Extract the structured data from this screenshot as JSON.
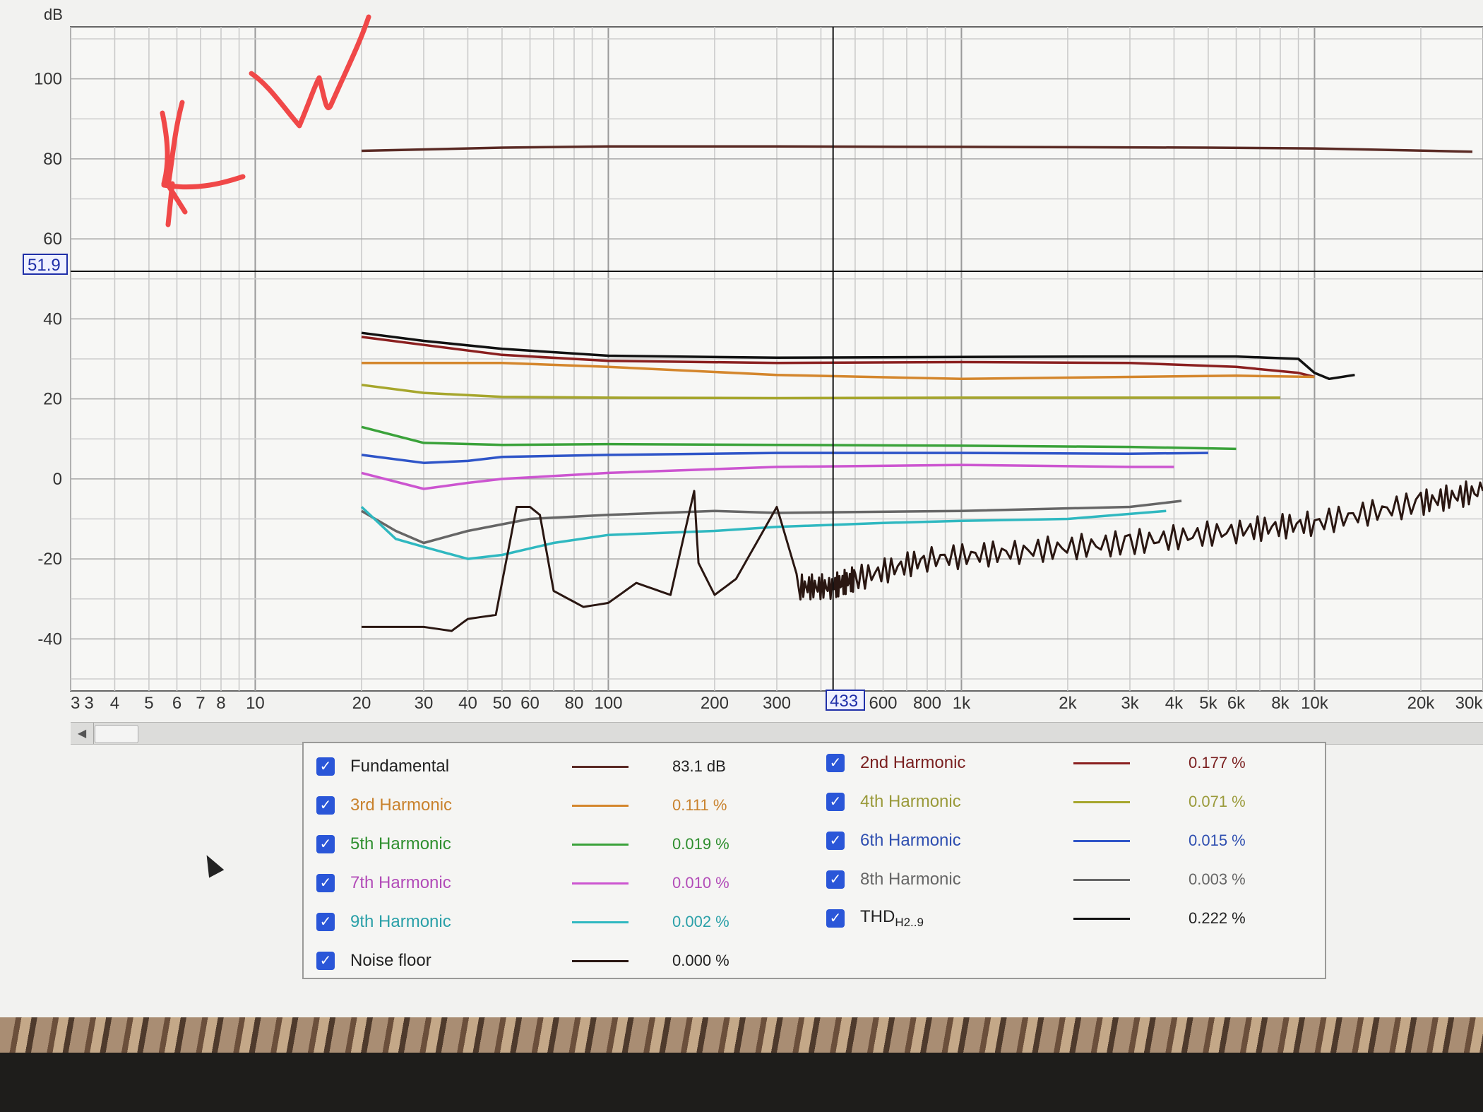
{
  "chart": {
    "ylabel": "dB",
    "y_ticks": [
      "100",
      "80",
      "60",
      "40",
      "20",
      "0",
      "-20",
      "-40"
    ],
    "x_ticks": [
      "3",
      "3",
      "4",
      "5",
      "6",
      "7",
      "8",
      "10",
      "20",
      "30",
      "40",
      "50",
      "60",
      "80",
      "100",
      "200",
      "300",
      "600",
      "800",
      "1k",
      "2k",
      "3k",
      "4k",
      "5k",
      "6k",
      "8k",
      "10k",
      "20k",
      "30k"
    ],
    "y_cursor_value": "51.9",
    "x_cursor_value": "433"
  },
  "chart_data": {
    "type": "line",
    "x_scale": "log",
    "x_unit": "Hz",
    "xlim": [
      3,
      30000
    ],
    "ylim": [
      -53,
      113
    ],
    "ylabel": "dB",
    "grid": true,
    "cursor": {
      "x": 433,
      "y": 51.9
    },
    "series": [
      {
        "name": "Fundamental",
        "color": "#5a2a24",
        "x": [
          20,
          50,
          100,
          300,
          1000,
          5000,
          10000,
          28000
        ],
        "y": [
          82,
          82.8,
          83.1,
          83.1,
          83,
          82.8,
          82.6,
          81.8
        ]
      },
      {
        "name": "THDH2..9",
        "color": "#111111",
        "x": [
          20,
          30,
          50,
          100,
          300,
          1000,
          3000,
          6000,
          9000,
          10000,
          11000,
          13000
        ],
        "y": [
          36.5,
          34.5,
          32.5,
          30.8,
          30.3,
          30.5,
          30.6,
          30.6,
          30,
          26.5,
          25,
          26
        ]
      },
      {
        "name": "2nd Harmonic",
        "color": "#8a1f1f",
        "x": [
          20,
          30,
          50,
          100,
          300,
          1000,
          3000,
          6000,
          9000,
          10000
        ],
        "y": [
          35.5,
          33.5,
          31,
          29.5,
          29,
          29.2,
          29,
          28,
          26.5,
          25.5
        ]
      },
      {
        "name": "3rd Harmonic",
        "color": "#d4862c",
        "x": [
          20,
          50,
          100,
          300,
          1000,
          3000,
          6000,
          10000
        ],
        "y": [
          29,
          29,
          28,
          26,
          25,
          25.5,
          25.8,
          25.5
        ]
      },
      {
        "name": "4th Harmonic",
        "color": "#a6a62c",
        "x": [
          20,
          30,
          50,
          100,
          300,
          1000,
          3000,
          8000
        ],
        "y": [
          23.5,
          21.5,
          20.5,
          20.3,
          20.2,
          20.3,
          20.3,
          20.3
        ]
      },
      {
        "name": "5th Harmonic",
        "color": "#3aa23a",
        "x": [
          20,
          30,
          50,
          100,
          300,
          1000,
          3000,
          6000
        ],
        "y": [
          13,
          9,
          8.5,
          8.7,
          8.5,
          8.3,
          8,
          7.5
        ]
      },
      {
        "name": "6th Harmonic",
        "color": "#2f55c8",
        "x": [
          20,
          30,
          40,
          50,
          100,
          300,
          1000,
          3000,
          5000
        ],
        "y": [
          6,
          4,
          4.5,
          5.5,
          6,
          6.5,
          6.5,
          6.3,
          6.5
        ]
      },
      {
        "name": "7th Harmonic",
        "color": "#cc55d0",
        "x": [
          20,
          30,
          40,
          50,
          100,
          300,
          1000,
          3000,
          4000
        ],
        "y": [
          1.5,
          -2.5,
          -1,
          0,
          1.5,
          3,
          3.5,
          3,
          3
        ]
      },
      {
        "name": "8th Harmonic",
        "color": "#666666",
        "x": [
          20,
          25,
          30,
          40,
          60,
          100,
          200,
          300,
          1000,
          3000,
          4200
        ],
        "y": [
          -8,
          -13,
          -16,
          -13,
          -10,
          -9,
          -8,
          -8.5,
          -8,
          -7,
          -5.5
        ]
      },
      {
        "name": "9th Harmonic",
        "color": "#2fb8c0",
        "x": [
          20,
          25,
          30,
          40,
          50,
          70,
          100,
          200,
          300,
          600,
          1000,
          2000,
          3800
        ],
        "y": [
          -7,
          -15,
          -17,
          -20,
          -19,
          -16,
          -14,
          -13,
          -12,
          -11,
          -10.5,
          -10,
          -8
        ]
      },
      {
        "name": "Noise floor",
        "color": "#2a1712",
        "x": [
          20,
          30,
          36,
          40,
          48,
          55,
          60,
          64,
          70,
          85,
          100,
          120,
          150,
          175,
          180,
          200,
          230,
          300,
          350,
          430,
          500,
          800,
          1500,
          3000,
          6000,
          10000,
          20000,
          30000
        ],
        "y": [
          -37,
          -37,
          -38,
          -35,
          -34,
          -7,
          -7,
          -9,
          -28,
          -32,
          -31,
          -26,
          -29,
          -3,
          -21,
          -29,
          -25,
          -7,
          -27,
          -27,
          -25,
          -20,
          -18,
          -16,
          -13,
          -11,
          -6,
          -3
        ]
      }
    ]
  },
  "legend": {
    "items": [
      {
        "label": "Fundamental",
        "value": "83.1 dB",
        "color": "#5a2a24",
        "value_color": "#222222"
      },
      {
        "label": "2nd Harmonic",
        "value": "0.177 %",
        "color": "#8a1f1f",
        "value_color": "#7a1f1f"
      },
      {
        "label": "3rd Harmonic",
        "value": "0.111 %",
        "color": "#d4862c",
        "value_color": "#c9822d"
      },
      {
        "label": "4th Harmonic",
        "value": "0.071 %",
        "color": "#a6a62c",
        "value_color": "#9a9a3a"
      },
      {
        "label": "5th Harmonic",
        "value": "0.019 %",
        "color": "#3aa23a",
        "value_color": "#2f8f2f"
      },
      {
        "label": "6th Harmonic",
        "value": "0.015 %",
        "color": "#2f55c8",
        "value_color": "#2f4fb0"
      },
      {
        "label": "7th Harmonic",
        "value": "0.010 %",
        "color": "#cc55d0",
        "value_color": "#b24cb8"
      },
      {
        "label": "8th Harmonic",
        "value": "0.003 %",
        "color": "#666666",
        "value_color": "#666666"
      },
      {
        "label": "9th Harmonic",
        "value": "0.002 %",
        "color": "#2fb8c0",
        "value_color": "#2aa0a8"
      },
      {
        "label": "THD",
        "label_sub": "H2..9",
        "value": "0.222 %",
        "color": "#111111",
        "value_color": "#222222"
      },
      {
        "label": "Noise floor",
        "value": "0.000 %",
        "color": "#2a1712",
        "value_color": "#222222"
      }
    ],
    "check_glyph": "✓"
  },
  "annotation": {
    "color": "#f04848"
  }
}
